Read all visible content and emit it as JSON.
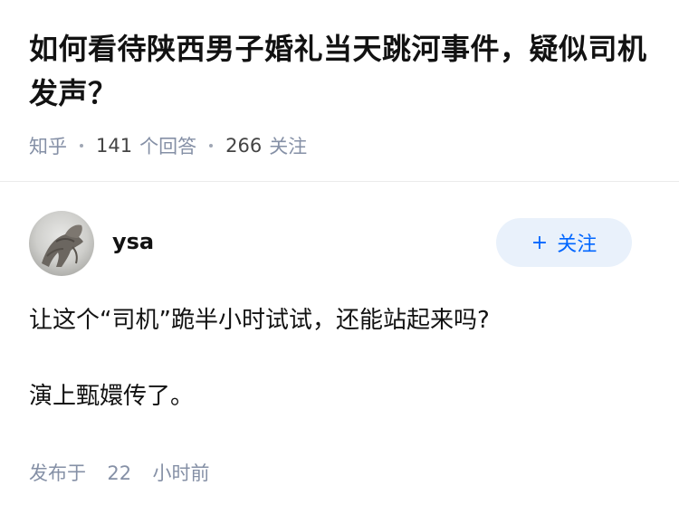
{
  "question": {
    "title": "如何看待陕西男子婚礼当天跳河事件，疑似司机发声？",
    "source": "知乎",
    "answers_count": "141",
    "answers_label": "个回答",
    "followers_count": "266",
    "followers_label": "关注"
  },
  "answer": {
    "author_name": "ysa",
    "follow_button": {
      "icon": "plus-icon",
      "label": "关注"
    },
    "paragraphs": [
      "让这个“司机”跪半小时试试，还能站起来吗?",
      "演上甄嬛传了。"
    ],
    "published_label": "发布于",
    "published_value": "22",
    "published_unit": "小时前"
  },
  "colors": {
    "title": "#121212",
    "meta": "#8590a6",
    "accent": "#0066ff",
    "follow_bg": "#e9f1fb"
  }
}
